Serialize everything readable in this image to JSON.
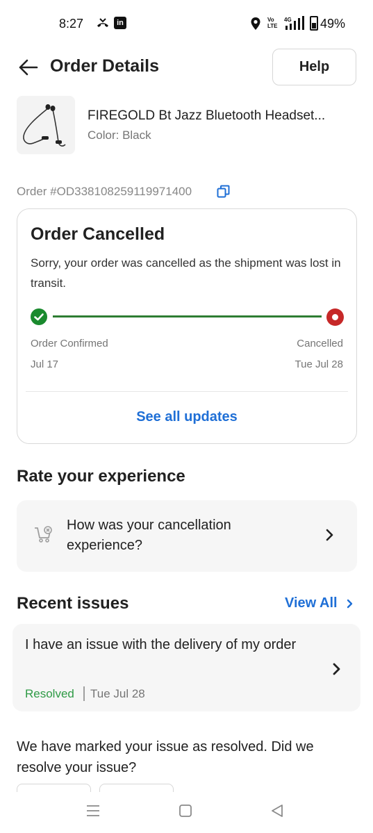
{
  "status_bar": {
    "time": "8:27",
    "linkedin_badge": "in",
    "volte_label": "Vo LTE",
    "battery_percent": "49%",
    "battery_level": 0.49
  },
  "header": {
    "title": "Order Details",
    "help_label": "Help"
  },
  "product": {
    "name": "FIREGOLD Bt Jazz Bluetooth Headset...",
    "color": "Color: Black"
  },
  "order": {
    "id_text": "Order #OD338108259119971400"
  },
  "status_card": {
    "title": "Order Cancelled",
    "message": "Sorry, your order was cancelled as the shipment was lost in transit.",
    "step_start_label": "Order Confirmed",
    "step_start_date": "Jul 17",
    "step_end_label": "Cancelled",
    "step_end_date": "Tue Jul 28",
    "see_updates_label": "See all updates",
    "colors": {
      "confirmed": "#1a8a2e",
      "cancelled": "#c62828",
      "link": "#1f6fd6"
    }
  },
  "rate": {
    "heading": "Rate your experience",
    "prompt": "How was your cancellation experience?",
    "icon": "cart-cancel-icon"
  },
  "issues": {
    "heading": "Recent issues",
    "view_all_label": "View All",
    "items": [
      {
        "text": "I have an issue with the delivery of my order",
        "status": "Resolved",
        "date": "Tue Jul 28"
      }
    ]
  },
  "resolve": {
    "question": "We have marked your issue as resolved. Did we resolve your issue?"
  },
  "nav_bar": {
    "icons": [
      "menu-icon",
      "home-icon",
      "back-icon"
    ]
  }
}
